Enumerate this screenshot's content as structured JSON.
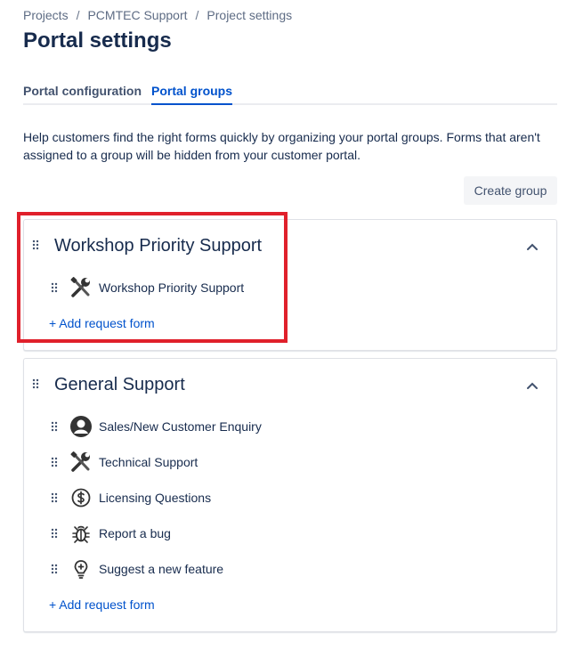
{
  "breadcrumb": [
    "Projects",
    "PCMTEC Support",
    "Project settings"
  ],
  "page_title": "Portal settings",
  "tabs": [
    {
      "label": "Portal configuration",
      "active": false
    },
    {
      "label": "Portal groups",
      "active": true
    }
  ],
  "description": "Help customers find the right forms quickly by organizing your portal groups. Forms that aren't assigned to a group will be hidden from your customer portal.",
  "create_group_label": "Create group",
  "groups": [
    {
      "title": "Workshop Priority Support",
      "items": [
        {
          "label": "Workshop Priority Support",
          "icon": "tools-icon"
        }
      ],
      "add_label": "+ Add request form"
    },
    {
      "title": "General Support",
      "items": [
        {
          "label": "Sales/New Customer Enquiry",
          "icon": "user-avatar-icon"
        },
        {
          "label": "Technical Support",
          "icon": "tools-icon"
        },
        {
          "label": "Licensing Questions",
          "icon": "dollar-icon"
        },
        {
          "label": "Report a bug",
          "icon": "bug-icon"
        },
        {
          "label": "Suggest a new feature",
          "icon": "lightbulb-icon"
        }
      ],
      "add_label": "+ Add request form"
    }
  ],
  "colors": {
    "accent": "#0052cc",
    "highlight": "#e0202b",
    "text": "#172b4d"
  }
}
